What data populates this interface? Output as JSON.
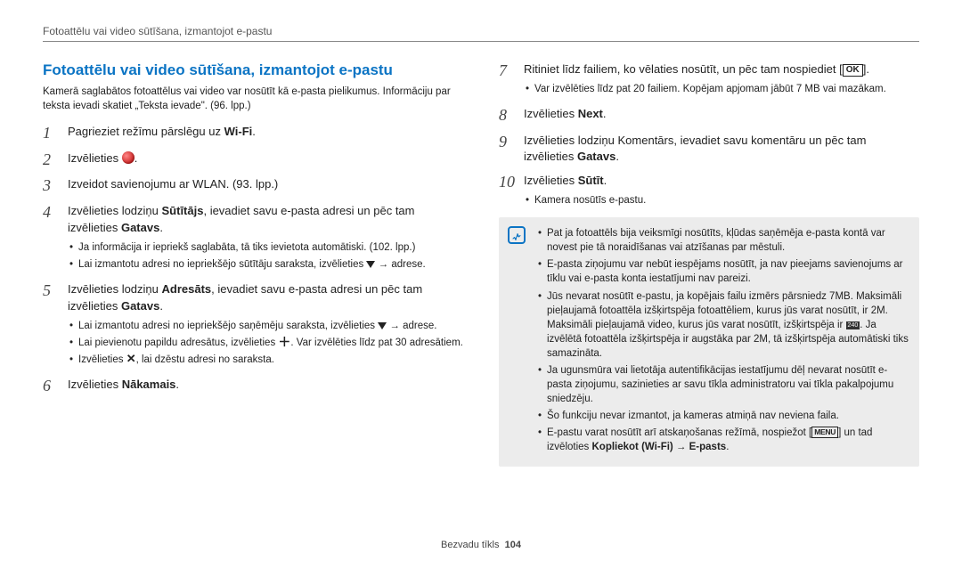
{
  "header": {
    "breadcrumb": "Fotoattēlu vai video sūtīšana, izmantojot e-pastu"
  },
  "title": "Fotoattēlu vai video sūtīšana, izmantojot e-pastu",
  "intro": "Kamerā saglabātos fotoattēlus vai video var nosūtīt kā e-pasta pielikumus. Informāciju par teksta ievadi skatiet „Teksta ievade\". (96. lpp.)",
  "steps": {
    "s1": {
      "n": "1",
      "text_a": "Pagrieziet režīmu pārslēgu uz ",
      "wifi": "Wi-Fi",
      "text_b": "."
    },
    "s2": {
      "n": "2",
      "text_a": "Izvēlieties ",
      "text_b": "."
    },
    "s3": {
      "n": "3",
      "text": "Izveidot savienojumu ar WLAN. (93. lpp.)"
    },
    "s4": {
      "n": "4",
      "text_a": "Izvēlieties lodziņu ",
      "bold1": "Sūtītājs",
      "text_b": ", ievadiet savu e-pasta adresi un pēc tam izvēlieties ",
      "bold2": "Gatavs",
      "text_c": ".",
      "bullets": [
        "Ja informācija ir iepriekš saglabāta, tā tiks ievietota automātiski. (102. lpp.)"
      ],
      "bullet_arrow": {
        "pre": "Lai izmantotu adresi no iepriekšējo sūtītāju saraksta, izvēlieties ",
        "post": " → adrese."
      }
    },
    "s5": {
      "n": "5",
      "text_a": "Izvēlieties lodziņu ",
      "bold1": "Adresāts",
      "text_b": ", ievadiet savu e-pasta adresi un pēc tam izvēlieties ",
      "bold2": "Gatavs",
      "text_c": ".",
      "b1": {
        "pre": "Lai izmantotu adresi no iepriekšējo saņēmēju saraksta, izvēlieties ",
        "post": " → adrese."
      },
      "b2": {
        "pre": "Lai pievienotu papildu adresātus, izvēlieties ",
        "post": ". Var izvēlēties līdz pat 30 adresātiem."
      },
      "b3": {
        "pre": "Izvēlieties ",
        "post": ", lai dzēstu adresi no saraksta."
      }
    },
    "s6": {
      "n": "6",
      "text_a": "Izvēlieties ",
      "bold": "Nākamais",
      "text_b": "."
    },
    "s7": {
      "n": "7",
      "text_a": "Ritiniet līdz failiem, ko vēlaties nosūtīt, un pēc tam nospiediet ",
      "ok": "OK",
      "text_b": ".",
      "bullets": [
        "Var izvēlēties līdz pat 20 failiem. Kopējam apjomam jābūt 7 MB vai mazākam."
      ]
    },
    "s8": {
      "n": "8",
      "text_a": "Izvēlieties ",
      "bold": "Next",
      "text_b": "."
    },
    "s9": {
      "n": "9",
      "text_a": "Izvēlieties lodziņu Komentārs, ievadiet savu komentāru un pēc tam izvēlieties ",
      "bold": "Gatavs",
      "text_b": "."
    },
    "s10": {
      "n": "10",
      "text_a": "Izvēlieties ",
      "bold": "Sūtīt",
      "text_b": ".",
      "bullets": [
        "Kamera nosūtīs e-pastu."
      ]
    }
  },
  "note": {
    "items": [
      "Pat ja fotoattēls bija veiksmīgi nosūtīts, kļūdas saņēmēja e-pasta kontā var novest pie tā noraidīšanas vai atzīšanas par mēstuli.",
      "E-pasta ziņojumu var nebūt iespējams nosūtīt, ja nav pieejams savienojums ar tīklu vai e-pasta konta iestatījumi nav pareizi."
    ],
    "size_item": {
      "pre": "Jūs nevarat nosūtīt e-pastu, ja kopējais failu izmērs pārsniedz 7MB. Maksimāli pieļaujamā fotoattēla izšķirtspēja fotoattēliem, kurus jūs varat nosūtīt, ir 2M. Maksimāli pieļaujamā video, kurus jūs varat nosūtīt, izšķirtspēja ir ",
      "res": "240",
      "post": ". Ja izvēlētā fotoattēla izšķirtspēja ir augstāka par 2M, tā izšķirtspēja automātiski tiks samazināta."
    },
    "items2": [
      "Ja ugunsmūra vai lietotāja autentifikācijas iestatījumu dēļ nevarat nosūtīt e-pasta ziņojumu, sazinieties ar savu tīkla administratoru vai tīkla pakalpojumu sniedzēju.",
      "Šo funkciju nevar izmantot, ja kameras atmiņā nav neviena faila."
    ],
    "menu_item": {
      "pre": "E-pastu varat nosūtīt arī atskaņošanas režīmā, nospiežot ",
      "menu": "MENU",
      "mid": " un tad izvēloties ",
      "bold": "Kopliekot (Wi-Fi) → E-pasts",
      "post": "."
    }
  },
  "footer": {
    "section": "Bezvadu tīkls",
    "page": "104"
  }
}
